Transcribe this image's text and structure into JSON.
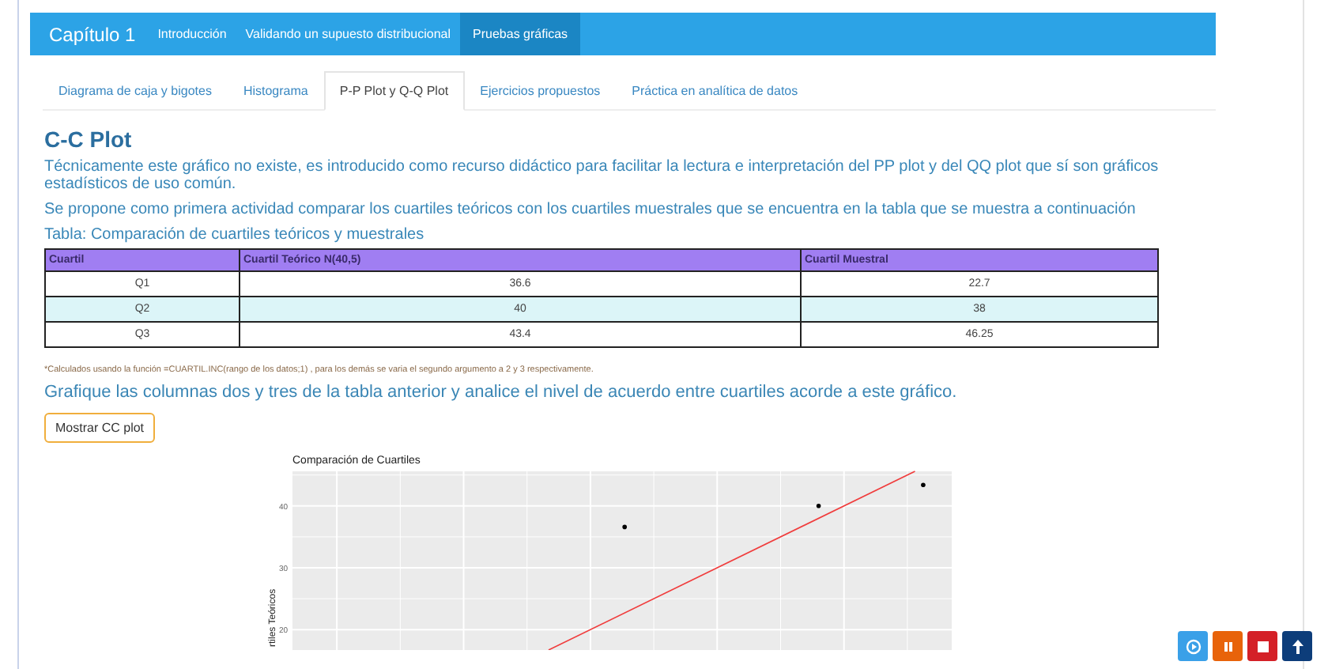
{
  "navbar": {
    "brand": "Capítulo 1",
    "items": [
      {
        "label": "Introducción",
        "selected": false
      },
      {
        "label": "Validando un supuesto distribucional",
        "selected": false
      },
      {
        "label": "Pruebas gráficas",
        "selected": true
      }
    ]
  },
  "tabs": [
    {
      "label": "Diagrama de caja y bigotes",
      "selected": false
    },
    {
      "label": "Histograma",
      "selected": false
    },
    {
      "label": "P-P Plot y Q-Q Plot",
      "selected": true
    },
    {
      "label": "Ejercicios propuestos",
      "selected": false
    },
    {
      "label": "Práctica en analítica de datos",
      "selected": false
    }
  ],
  "heading": "C-C Plot",
  "paragraphs": [
    "Técnicamente este gráfico no existe, es introducido como recurso didáctico para facilitar la lectura e interpretación del PP plot y del QQ plot que sí son gráficos estadísticos de uso común.",
    "Se propone como primera actividad comparar los cuartiles teóricos con los cuartiles muestrales que se encuentra en la tabla que se muestra a continuación"
  ],
  "table_caption": "Tabla: Comparación de cuartiles teóricos y muestrales",
  "table": {
    "columns": [
      "Cuartil",
      "Cuartil Teórico N(40,5)",
      "Cuartil Muestral"
    ],
    "rows": [
      {
        "cells": [
          "Q1",
          "36.6",
          "22.7"
        ],
        "highlighted": false
      },
      {
        "cells": [
          "Q2",
          "40",
          "38"
        ],
        "highlighted": true
      },
      {
        "cells": [
          "Q3",
          "43.4",
          "46.25"
        ],
        "highlighted": false
      }
    ]
  },
  "footnote": "*Calculados usando la función =CUARTIL.INC(rango de los datos;1) , para los demás se varia el segundo argumento a 2 y 3 respectivamente.",
  "instruction": "Grafique las columnas dos y tres de la tabla anterior y analice el nivel de acuerdo entre cuartiles acorde a este gráfico.",
  "button": "Mostrar CC plot",
  "plot": {
    "title": "Comparación de Cuartiles",
    "y_axis_title": "rtiles Teóricos",
    "y_ticks": [
      "40",
      "30",
      "20"
    ]
  },
  "float_buttons": [
    {
      "kind": "play",
      "color": "#3aa0e8"
    },
    {
      "kind": "pause",
      "color": "#e8630a"
    },
    {
      "kind": "stop",
      "color": "#d42027"
    },
    {
      "kind": "up",
      "color": "#0d3d7a"
    }
  ]
}
